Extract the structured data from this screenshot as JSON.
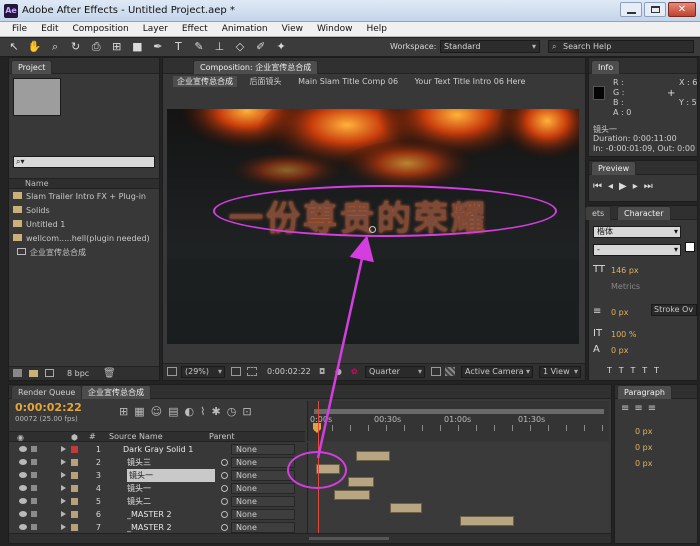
{
  "window": {
    "title": "Adobe After Effects - Untitled Project.aep *"
  },
  "menu": [
    "File",
    "Edit",
    "Composition",
    "Layer",
    "Effect",
    "Animation",
    "View",
    "Window",
    "Help"
  ],
  "toolbar": {
    "workspace_label": "Workspace:",
    "workspace_value": "Standard",
    "search_placeholder": "Search Help"
  },
  "project": {
    "tab": "Project",
    "column_name": "Name",
    "items": [
      "Slam Trailer Intro FX + Plug-in",
      "Solids",
      "Untitled 1",
      "wellcom.....hell(plugin needed)",
      "企业宣传总合成"
    ],
    "bpc": "8 bpc"
  },
  "composition": {
    "panel_tab": "Composition: 企业宣传总合成",
    "tabs": [
      "企业宣传总合成",
      "后面镜头",
      "Main Slam Title Comp 06",
      "Your Text Title Intro 06 Here"
    ],
    "viewer_text": "一份尊贵的荣耀",
    "zoom": "(29%)",
    "timecode": "0:00:02:22",
    "resolution": "Quarter",
    "camera": "Active Camera",
    "view": "1 View"
  },
  "info": {
    "tab": "Info",
    "r": "R :",
    "g": "G :",
    "b": "B :",
    "a": "A : 0",
    "x": "X : 6",
    "y": "Y : 5",
    "layer_name": "镜头一",
    "duration": "Duration: 0:00:11:00",
    "in_out": "In: -0:00:01:09, Out: 0:00"
  },
  "preview": {
    "tab": "Preview"
  },
  "character": {
    "tab_ets": "ets",
    "tab": "Character",
    "font": "楷体",
    "style": "-",
    "size": "146 px",
    "metrics": "Metrics",
    "stroke_width": "0 px",
    "stroke_over": "Stroke Ov",
    "scale": "100 %",
    "baseline": "0 px"
  },
  "paragraph": {
    "tab": "Paragraph",
    "v1": "0 px",
    "v2": "0 px",
    "v3": "0 px"
  },
  "timeline": {
    "tabs": [
      "Render Queue",
      "企业宣传总合成"
    ],
    "timecode": "0:00:02:22",
    "fps": "00072 (25.00 fps)",
    "col_source": "Source Name",
    "col_parent": "Parent",
    "ruler": [
      "0:00s",
      "00:30s",
      "01:00s",
      "01:30s"
    ],
    "layers": [
      {
        "num": "1",
        "name": "Dark Gray Solid 1",
        "parent": "None",
        "color": "#c43a3a"
      },
      {
        "num": "2",
        "name": "镜头三",
        "parent": "None",
        "color": "#b7a07a"
      },
      {
        "num": "3",
        "name": "镜头一",
        "parent": "None",
        "color": "#b7a07a"
      },
      {
        "num": "4",
        "name": "镜头一",
        "parent": "None",
        "color": "#b7a07a"
      },
      {
        "num": "5",
        "name": "镜头二",
        "parent": "None",
        "color": "#b7a07a"
      },
      {
        "num": "6",
        "name": "_MASTER 2",
        "parent": "None",
        "color": "#b7a07a"
      },
      {
        "num": "7",
        "name": "_MASTER 2",
        "parent": "None",
        "color": "#b7a07a"
      }
    ]
  }
}
